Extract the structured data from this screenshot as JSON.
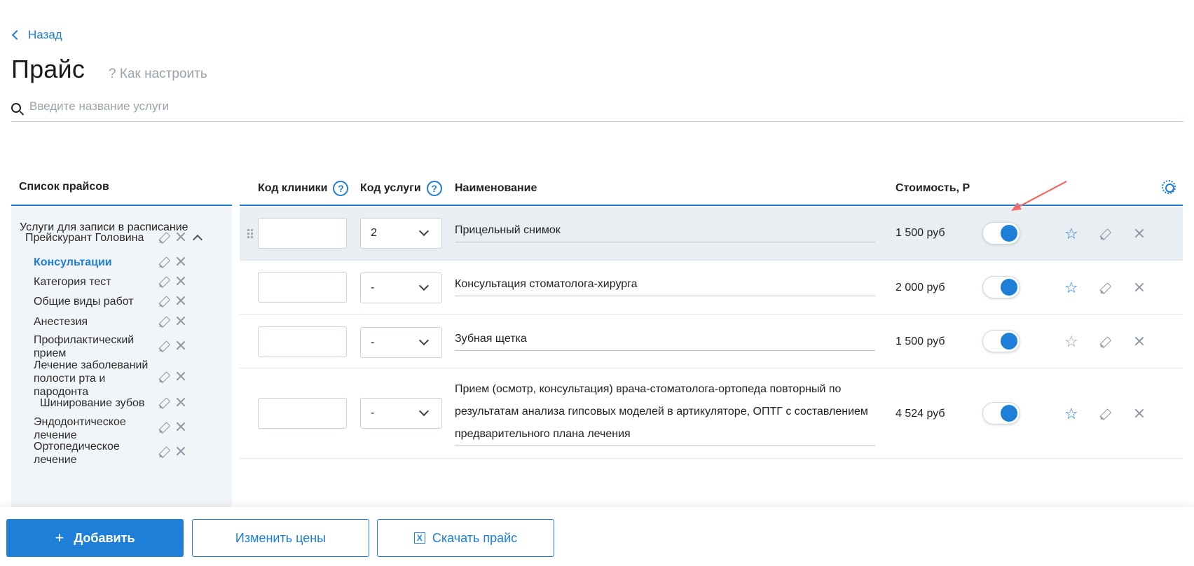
{
  "nav": {
    "back_label": "Назад"
  },
  "page": {
    "title": "Прайс",
    "howto_label": "? Как настроить"
  },
  "search": {
    "placeholder": "Введите название услуги"
  },
  "sidebar": {
    "header": "Список прайсов",
    "root_label": "Услуги для записи в расписание",
    "group_label": "Прейскурант Головина",
    "items": [
      {
        "label": "Консультации",
        "active": true
      },
      {
        "label": "Категория тест"
      },
      {
        "label": "Общие виды работ"
      },
      {
        "label": "Анестезия"
      },
      {
        "label": "Профилактический прием"
      },
      {
        "label": "Лечение заболеваний полости рта и пародонта"
      },
      {
        "label": "Шинирование зубов"
      },
      {
        "label": "Эндодонтическое лечение"
      },
      {
        "label": "Ортопедическое лечение"
      }
    ]
  },
  "table": {
    "columns": {
      "clinic_code": "Код клиники",
      "service_code": "Код услуги",
      "name": "Наименование",
      "price": "Стоимость, Р"
    },
    "rows": [
      {
        "clinic_code": "",
        "service_code": "2",
        "name": "Прицельный снимок",
        "price": "1 500 руб",
        "enabled": true,
        "favorite": true
      },
      {
        "clinic_code": "",
        "service_code": "-",
        "name": "Консультация стоматолога-хирурга",
        "price": "2 000 руб",
        "enabled": true,
        "favorite": true
      },
      {
        "clinic_code": "",
        "service_code": "-",
        "name": "Зубная щетка",
        "price": "1 500 руб",
        "enabled": true,
        "favorite": false
      },
      {
        "clinic_code": "",
        "service_code": "-",
        "name": "Прием (осмотр, консультация) врача-стоматолога-ортопеда повторный по результатам анализа гипсовых моделей в артикуляторе, ОПТГ с составлением предварительного плана лечения",
        "price": "4 524 руб",
        "enabled": true,
        "favorite": true
      }
    ]
  },
  "actions": {
    "add_label": "Добавить",
    "change_prices_label": "Изменить цены",
    "download_label": "Скачать прайс"
  },
  "colors": {
    "accent": "#1e7fd8",
    "arrow": "#f06a6a",
    "sidebar_bg": "#f2f5f8",
    "highlight_row": "#e9eef2"
  }
}
